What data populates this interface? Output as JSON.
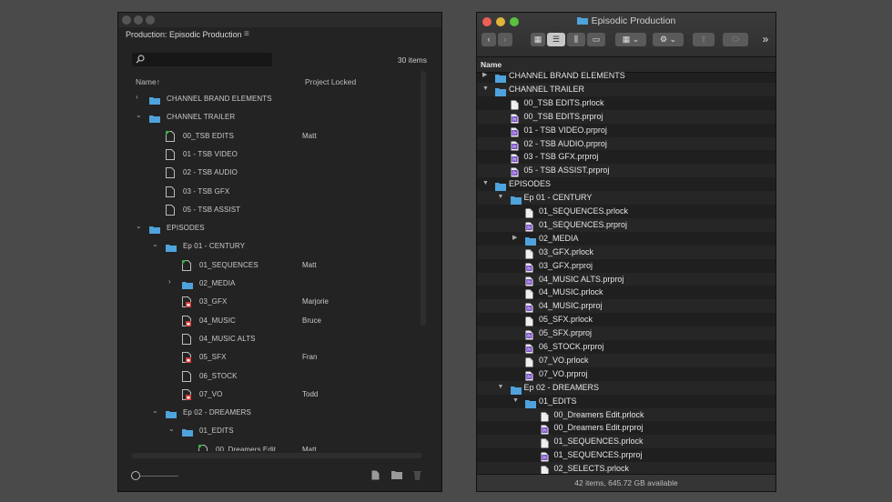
{
  "colors": {
    "folder": "#4fa3dc",
    "prproj": "#7b4fc9",
    "red": "#d23c3c",
    "green": "#3fae49"
  },
  "premiere": {
    "title": "Production: Episodic Production",
    "menu_icon": "≡",
    "item_count": "30 items",
    "col_name": "Name",
    "sort_indicator": "↑",
    "col_locked": "Project Locked",
    "rows": [
      {
        "depth": 0,
        "twisty": "›",
        "icon": "folder",
        "name": "CHANNEL BRAND ELEMENTS",
        "locked": ""
      },
      {
        "depth": 0,
        "twisty": "⌄",
        "icon": "folder",
        "name": "CHANNEL TRAILER",
        "locked": ""
      },
      {
        "depth": 1,
        "twisty": "",
        "icon": "proj-green",
        "name": "00_TSB EDITS",
        "locked": "Matt"
      },
      {
        "depth": 1,
        "twisty": "",
        "icon": "proj",
        "name": "01 - TSB VIDEO",
        "locked": ""
      },
      {
        "depth": 1,
        "twisty": "",
        "icon": "proj",
        "name": "02 - TSB AUDIO",
        "locked": ""
      },
      {
        "depth": 1,
        "twisty": "",
        "icon": "proj",
        "name": "03 - TSB GFX",
        "locked": ""
      },
      {
        "depth": 1,
        "twisty": "",
        "icon": "proj",
        "name": "05 - TSB ASSIST",
        "locked": ""
      },
      {
        "depth": 0,
        "twisty": "⌄",
        "icon": "folder",
        "name": "EPISODES",
        "locked": ""
      },
      {
        "depth": 1,
        "twisty": "⌄",
        "icon": "folder",
        "name": "Ep 01 - CENTURY",
        "locked": ""
      },
      {
        "depth": 2,
        "twisty": "",
        "icon": "proj-green",
        "name": "01_SEQUENCES",
        "locked": "Matt"
      },
      {
        "depth": 2,
        "twisty": "›",
        "icon": "folder",
        "name": "02_MEDIA",
        "locked": ""
      },
      {
        "depth": 2,
        "twisty": "",
        "icon": "proj-red",
        "name": "03_GFX",
        "locked": "Marjorie"
      },
      {
        "depth": 2,
        "twisty": "",
        "icon": "proj-red",
        "name": "04_MUSIC",
        "locked": "Bruce"
      },
      {
        "depth": 2,
        "twisty": "",
        "icon": "proj",
        "name": "04_MUSIC ALTS",
        "locked": ""
      },
      {
        "depth": 2,
        "twisty": "",
        "icon": "proj-red",
        "name": "05_SFX",
        "locked": "Fran"
      },
      {
        "depth": 2,
        "twisty": "",
        "icon": "proj",
        "name": "06_STOCK",
        "locked": ""
      },
      {
        "depth": 2,
        "twisty": "",
        "icon": "proj-red",
        "name": "07_VO",
        "locked": "Todd"
      },
      {
        "depth": 1,
        "twisty": "⌄",
        "icon": "folder",
        "name": "Ep 02 - DREAMERS",
        "locked": ""
      },
      {
        "depth": 2,
        "twisty": "⌄",
        "icon": "folder",
        "name": "01_EDITS",
        "locked": ""
      },
      {
        "depth": 3,
        "twisty": "",
        "icon": "proj-green",
        "name": "00_Dreamers Edit",
        "locked": "Matt"
      }
    ]
  },
  "finder": {
    "title": "Episodic Production",
    "col_name": "Name",
    "overflow": "»",
    "status": "42 items, 645.72 GB available",
    "rows": [
      {
        "depth": 0,
        "twisty": "▶",
        "icon": "folder",
        "name": "CHANNEL BRAND ELEMENTS"
      },
      {
        "depth": 0,
        "twisty": "▼",
        "icon": "folder",
        "name": "CHANNEL TRAILER"
      },
      {
        "depth": 1,
        "twisty": "",
        "icon": "doc",
        "name": "00_TSB EDITS.prlock"
      },
      {
        "depth": 1,
        "twisty": "",
        "icon": "prproj",
        "name": "00_TSB EDITS.prproj"
      },
      {
        "depth": 1,
        "twisty": "",
        "icon": "prproj",
        "name": "01 - TSB VIDEO.prproj"
      },
      {
        "depth": 1,
        "twisty": "",
        "icon": "prproj",
        "name": "02 - TSB AUDIO.prproj"
      },
      {
        "depth": 1,
        "twisty": "",
        "icon": "prproj",
        "name": "03 - TSB GFX.prproj"
      },
      {
        "depth": 1,
        "twisty": "",
        "icon": "prproj",
        "name": "05 - TSB ASSIST.prproj"
      },
      {
        "depth": 0,
        "twisty": "▼",
        "icon": "folder",
        "name": "EPISODES"
      },
      {
        "depth": 1,
        "twisty": "▼",
        "icon": "folder",
        "name": "Ep 01 - CENTURY"
      },
      {
        "depth": 2,
        "twisty": "",
        "icon": "doc",
        "name": "01_SEQUENCES.prlock"
      },
      {
        "depth": 2,
        "twisty": "",
        "icon": "prproj",
        "name": "01_SEQUENCES.prproj"
      },
      {
        "depth": 2,
        "twisty": "▶",
        "icon": "folder",
        "name": "02_MEDIA"
      },
      {
        "depth": 2,
        "twisty": "",
        "icon": "doc",
        "name": "03_GFX.prlock"
      },
      {
        "depth": 2,
        "twisty": "",
        "icon": "prproj",
        "name": "03_GFX.prproj"
      },
      {
        "depth": 2,
        "twisty": "",
        "icon": "prproj",
        "name": "04_MUSIC ALTS.prproj"
      },
      {
        "depth": 2,
        "twisty": "",
        "icon": "doc",
        "name": "04_MUSIC.prlock"
      },
      {
        "depth": 2,
        "twisty": "",
        "icon": "prproj",
        "name": "04_MUSIC.prproj"
      },
      {
        "depth": 2,
        "twisty": "",
        "icon": "doc",
        "name": "05_SFX.prlock"
      },
      {
        "depth": 2,
        "twisty": "",
        "icon": "prproj",
        "name": "05_SFX.prproj"
      },
      {
        "depth": 2,
        "twisty": "",
        "icon": "prproj",
        "name": "06_STOCK.prproj"
      },
      {
        "depth": 2,
        "twisty": "",
        "icon": "doc",
        "name": "07_VO.prlock"
      },
      {
        "depth": 2,
        "twisty": "",
        "icon": "prproj",
        "name": "07_VO.prproj"
      },
      {
        "depth": 1,
        "twisty": "▼",
        "icon": "folder",
        "name": "Ep 02 - DREAMERS"
      },
      {
        "depth": 2,
        "twisty": "▼",
        "icon": "folder",
        "name": "01_EDITS"
      },
      {
        "depth": 3,
        "twisty": "",
        "icon": "doc",
        "name": "00_Dreamers Edit.prlock"
      },
      {
        "depth": 3,
        "twisty": "",
        "icon": "prproj",
        "name": "00_Dreamers Edit.prproj"
      },
      {
        "depth": 3,
        "twisty": "",
        "icon": "doc",
        "name": "01_SEQUENCES.prlock"
      },
      {
        "depth": 3,
        "twisty": "",
        "icon": "prproj",
        "name": "01_SEQUENCES.prproj"
      },
      {
        "depth": 3,
        "twisty": "",
        "icon": "doc",
        "name": "02_SELECTS.prlock"
      }
    ]
  }
}
